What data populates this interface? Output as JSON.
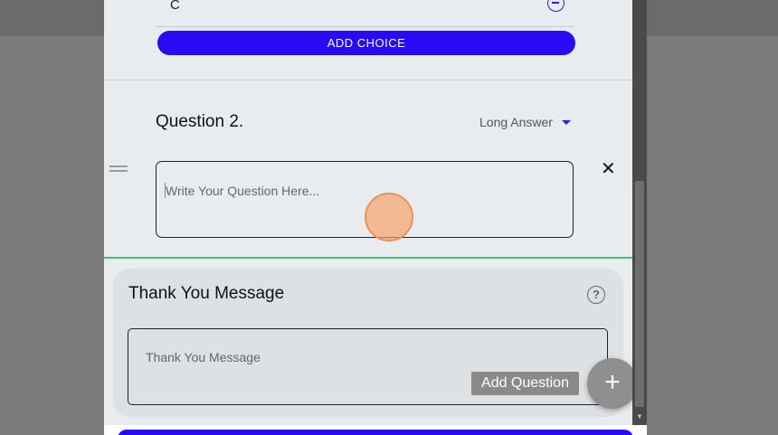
{
  "choice": {
    "label": "C",
    "remove_icon": "minus-circle-icon"
  },
  "add_choice_label": "ADD CHOICE",
  "question": {
    "title": "Question 2.",
    "type_label": "Long Answer",
    "placeholder": "Write Your Question Here...",
    "drag_icon": "drag-handle-icon",
    "close_icon": "close-icon"
  },
  "thanks": {
    "title": "Thank You Message",
    "help_icon": "help-icon",
    "help_glyph": "?",
    "placeholder": "Thank You Message"
  },
  "tooltip_label": "Add Question",
  "fab_glyph": "+",
  "close_glyph": "✕",
  "colors": {
    "accent": "#2a0af5",
    "success": "#3fc07a"
  }
}
